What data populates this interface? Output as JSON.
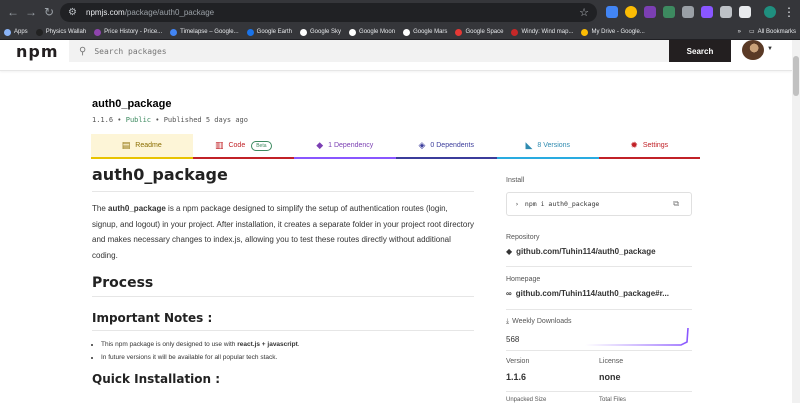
{
  "browser": {
    "url_host": "npmjs.com",
    "url_path": "/package/auth0_package",
    "bookmarks": [
      {
        "label": "Apps",
        "color": "#8ab4f8"
      },
      {
        "label": "Physics Wallah",
        "color": "#222222"
      },
      {
        "label": "Price History - Price...",
        "color": "#8e44ad"
      },
      {
        "label": "Timelapse – Google...",
        "color": "#4285f4"
      },
      {
        "label": "Google Earth",
        "color": "#1a73e8"
      },
      {
        "label": "Google Sky",
        "color": "#ffffff"
      },
      {
        "label": "Google Moon",
        "color": "#ffffff"
      },
      {
        "label": "Google Mars",
        "color": "#ffffff"
      },
      {
        "label": "Google Space",
        "color": "#e53935"
      },
      {
        "label": "Windy: Wind map...",
        "color": "#c62828"
      },
      {
        "label": "My Drive - Google...",
        "color": "#fbbc04"
      }
    ],
    "all_bookmarks": "All Bookmarks",
    "overflow": "»"
  },
  "header": {
    "logo": "npm",
    "search_placeholder": "Search packages",
    "search_button": "Search"
  },
  "package": {
    "name": "auth0_package",
    "version": "1.1.6",
    "visibility": "Public",
    "published": "Published 5 days ago",
    "sep": "•"
  },
  "tabs": {
    "readme": "Readme",
    "code": "Code",
    "beta": "Beta",
    "dependency": "1 Dependency",
    "dependents": "0 Dependents",
    "versions": "8 Versions",
    "settings": "Settings"
  },
  "readme": {
    "title": "auth0_package",
    "intro_prefix": "The ",
    "intro_bold": "auth0_package",
    "intro_rest": " is a npm package designed to simplify the setup of authentication routes (login, signup, and logout) in your project. After installation, it creates a separate folder in your project root directory and makes necessary changes to index.js, allowing you to test these routes directly without additional coding.",
    "process_heading": "Process",
    "notes_heading": "Important Notes :",
    "note1_prefix": "This npm package is only designed to use with ",
    "note1_bold": "react.js + javascript",
    "note1_suffix": ".",
    "note2": "In future versions it will be available for all popular tech stack.",
    "install_heading": "Quick Installation :"
  },
  "sidebar": {
    "install_label": "Install",
    "install_cmd": "npm i auth0_package",
    "repository_label": "Repository",
    "repository_link": "github.com/Tuhin114/auth0_package",
    "homepage_label": "Homepage",
    "homepage_link": "github.com/Tuhin114/auth0_package#r...",
    "weekly_downloads_label": "Weekly Downloads",
    "weekly_downloads": "568",
    "version_label": "Version",
    "version_value": "1.1.6",
    "license_label": "License",
    "license_value": "none",
    "unpacked_label": "Unpacked Size",
    "total_files_label": "Total Files"
  },
  "colors": {
    "accent_red": "#c12127",
    "readme_yellow": "#e8c300",
    "spark_purple": "#8956ff"
  }
}
